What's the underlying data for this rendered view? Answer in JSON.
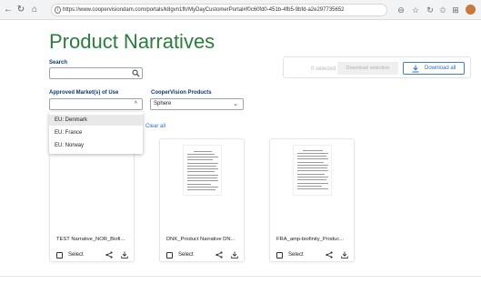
{
  "browser": {
    "url": "https://www.coopervisiondam.com/portals/k8gvn1fh/MyDayCustomerPortal#f0c60fd0-451b-4fb5-9bfd-a2e297735652"
  },
  "page": {
    "title": "Product Narratives",
    "search": {
      "label": "Search",
      "value": ""
    },
    "selection": {
      "count_text": "0 selected",
      "download_selection": "Download selection",
      "download_all": "Download all"
    },
    "filters": {
      "market_label": "Approved Market(s) of Use",
      "market_value": "",
      "products_label": "CooperVision Products",
      "products_value": "Sphere",
      "clear_all": "Clear all"
    },
    "market_options": [
      "EU: Denmark",
      "EU: France",
      "EU: Norway"
    ],
    "cards": [
      {
        "name": "TEST Narrative_NOR_Biofi...",
        "select": "Select"
      },
      {
        "name": "DNK_Product Narrative DN...",
        "select": "Select"
      },
      {
        "name": "FRA_amp-biofinity_Produc...",
        "select": "Select"
      }
    ]
  },
  "colors": {
    "title": "#2a7d3c",
    "label": "#0a3a70",
    "link": "#2e6fbd"
  }
}
